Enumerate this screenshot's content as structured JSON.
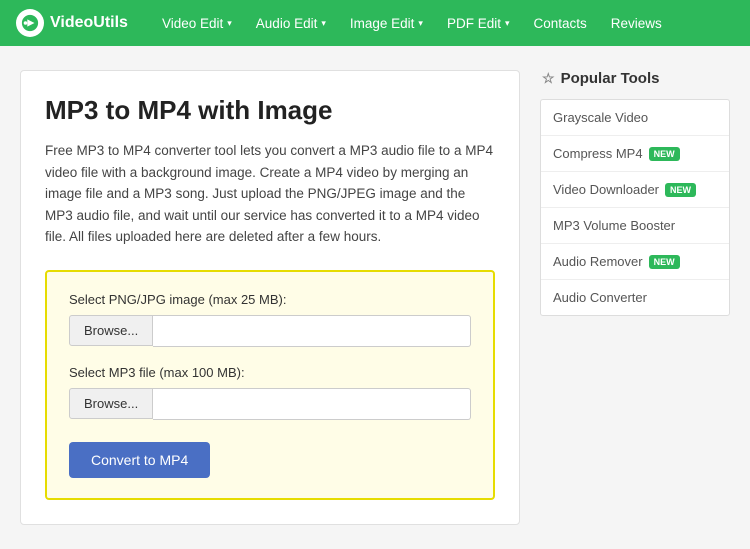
{
  "nav": {
    "logo_text": "VideoUtils",
    "links": [
      {
        "label": "Video Edit",
        "has_dropdown": true
      },
      {
        "label": "Audio Edit",
        "has_dropdown": true
      },
      {
        "label": "Image Edit",
        "has_dropdown": true
      },
      {
        "label": "PDF Edit",
        "has_dropdown": true
      },
      {
        "label": "Contacts",
        "has_dropdown": false
      },
      {
        "label": "Reviews",
        "has_dropdown": false
      }
    ]
  },
  "main": {
    "title": "MP3 to MP4 with Image",
    "description": "Free MP3 to MP4 converter tool lets you convert a MP3 audio file to a MP4 video file with a background image. Create a MP4 video by merging an image file and a MP3 song. Just upload the PNG/JPEG image and the MP3 audio file, and wait until our service has converted it to a MP4 video file. All files uploaded here are deleted after a few hours.",
    "image_label": "Select PNG/JPG image (max 25 MB):",
    "mp3_label": "Select MP3 file (max 100 MB):",
    "browse_label": "Browse...",
    "convert_label": "Convert to MP4"
  },
  "sidebar": {
    "header": "Popular Tools",
    "tools": [
      {
        "label": "Grayscale Video",
        "badge": null
      },
      {
        "label": "Compress MP4",
        "badge": "NEW"
      },
      {
        "label": "Video Downloader",
        "badge": "NEW"
      },
      {
        "label": "MP3 Volume Booster",
        "badge": null
      },
      {
        "label": "Audio Remover",
        "badge": "NEW"
      },
      {
        "label": "Audio Converter",
        "badge": null
      }
    ]
  }
}
